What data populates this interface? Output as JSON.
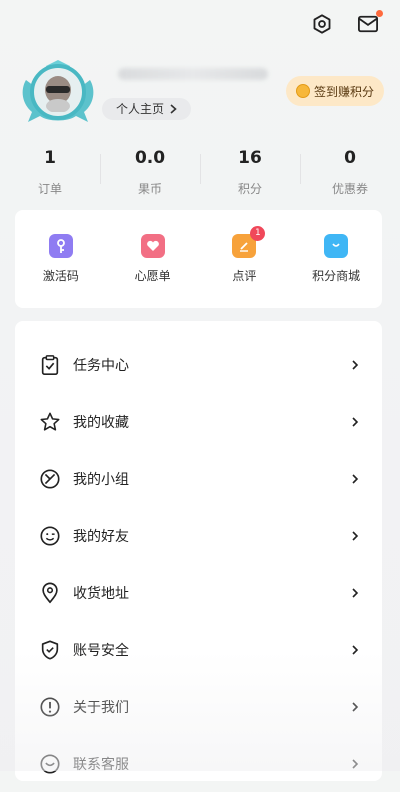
{
  "topbar": {
    "settings_icon": "settings-icon",
    "mail_icon": "mail-icon",
    "mail_has_notification": true
  },
  "profile": {
    "homepage_label": "个人主页",
    "checkin_label": "签到赚积分"
  },
  "stats": [
    {
      "value": "1",
      "label": "订单"
    },
    {
      "value": "0.0",
      "label": "果币"
    },
    {
      "value": "16",
      "label": "积分"
    },
    {
      "value": "0",
      "label": "优惠券"
    }
  ],
  "shortcuts": [
    {
      "label": "激活码",
      "icon": "key-icon",
      "color": "#8f7cf2"
    },
    {
      "label": "心愿单",
      "icon": "heart-icon",
      "color": "#f26f84"
    },
    {
      "label": "点评",
      "icon": "review-icon",
      "color": "#f7a23b",
      "badge": "1"
    },
    {
      "label": "积分商城",
      "icon": "shopping-bag-icon",
      "color": "#3fb6f5"
    }
  ],
  "menu": [
    {
      "label": "任务中心",
      "icon": "task-clipboard-icon"
    },
    {
      "label": "我的收藏",
      "icon": "star-icon"
    },
    {
      "label": "我的小组",
      "icon": "group-icon"
    },
    {
      "label": "我的好友",
      "icon": "friend-smile-icon"
    },
    {
      "label": "收货地址",
      "icon": "location-pin-icon"
    },
    {
      "label": "账号安全",
      "icon": "shield-icon"
    },
    {
      "label": "关于我们",
      "icon": "info-icon"
    },
    {
      "label": "联系客服",
      "icon": "customer-service-icon"
    }
  ]
}
